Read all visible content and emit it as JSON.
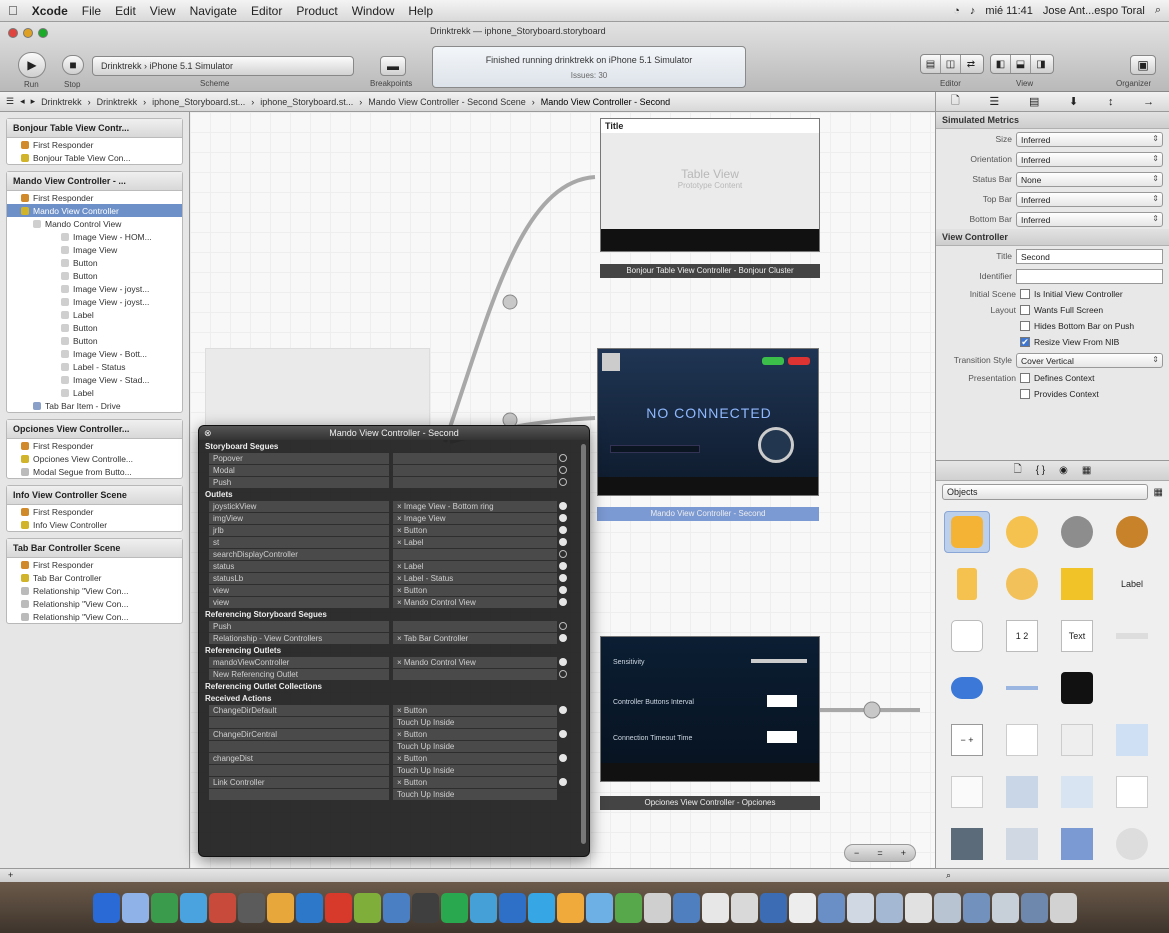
{
  "menubar": {
    "app": "Xcode",
    "menus": [
      "File",
      "Edit",
      "View",
      "Navigate",
      "Editor",
      "Product",
      "Window",
      "Help"
    ],
    "clock": "mié 11:41",
    "user": "Jose Ant...espo Toral"
  },
  "toolbar": {
    "run_label": "Run",
    "stop_label": "Stop",
    "scheme_value": "Drinktrekk › iPhone 5.1 Simulator",
    "scheme_label": "Scheme",
    "breakpoints_label": "Breakpoints",
    "doc_title": "Drinktrekk — iphone_Storyboard.storyboard",
    "status_text": "Finished running drinktrekk on iPhone 5.1 Simulator",
    "status_sub": "Issues: 30",
    "editor_label": "Editor",
    "view_label": "View",
    "organizer_label": "Organizer"
  },
  "jumpbar": {
    "crumbs": [
      "Drinktrekk",
      "Drinktrekk",
      "iphone_Storyboard.st...",
      "iphone_Storyboard.st...",
      "Mando View Controller - Second Scene",
      "Mando View Controller - Second"
    ]
  },
  "outline": {
    "scenes": [
      {
        "title": "Bonjour Table View Contr...",
        "items": [
          {
            "label": "First Responder",
            "level": 1,
            "color": "#d18a2a"
          },
          {
            "label": "Bonjour Table View Con...",
            "level": 1,
            "color": "#d1b42a"
          }
        ]
      },
      {
        "title": "Mando View Controller - ...",
        "items": [
          {
            "label": "First Responder",
            "level": 1,
            "color": "#d18a2a"
          },
          {
            "label": "Mando View Controller",
            "level": 1,
            "color": "#d1b42a",
            "selected": true
          },
          {
            "label": "Mando Control View",
            "level": 2,
            "color": "#cfcfcf"
          },
          {
            "label": "Image View - HOM...",
            "level": 3,
            "color": "#cfcfcf"
          },
          {
            "label": "Image View",
            "level": 3,
            "color": "#cfcfcf"
          },
          {
            "label": "Button",
            "level": 3,
            "color": "#cfcfcf"
          },
          {
            "label": "Button",
            "level": 3,
            "color": "#cfcfcf"
          },
          {
            "label": "Image View - joyst...",
            "level": 3,
            "color": "#cfcfcf"
          },
          {
            "label": "Image View - joyst...",
            "level": 3,
            "color": "#cfcfcf"
          },
          {
            "label": "Label",
            "level": 3,
            "color": "#cfcfcf"
          },
          {
            "label": "Button",
            "level": 3,
            "color": "#cfcfcf"
          },
          {
            "label": "Button",
            "level": 3,
            "color": "#cfcfcf"
          },
          {
            "label": "Image View - Bott...",
            "level": 3,
            "color": "#cfcfcf"
          },
          {
            "label": "Label - Status",
            "level": 3,
            "color": "#cfcfcf"
          },
          {
            "label": "Image View - Stad...",
            "level": 3,
            "color": "#cfcfcf"
          },
          {
            "label": "Label",
            "level": 3,
            "color": "#cfcfcf"
          },
          {
            "label": "Tab Bar Item - Drive",
            "level": 2,
            "color": "#8aa0c8"
          }
        ]
      },
      {
        "title": "Opciones View Controller...",
        "items": [
          {
            "label": "First Responder",
            "level": 1,
            "color": "#d18a2a"
          },
          {
            "label": "Opciones View Controlle...",
            "level": 1,
            "color": "#d1b42a"
          },
          {
            "label": "Modal Segue from Butto...",
            "level": 1,
            "color": "#bbbbbb"
          }
        ]
      },
      {
        "title": "Info View Controller Scene",
        "items": [
          {
            "label": "First Responder",
            "level": 1,
            "color": "#d18a2a"
          },
          {
            "label": "Info View Controller",
            "level": 1,
            "color": "#d1b42a"
          }
        ]
      },
      {
        "title": "Tab Bar Controller Scene",
        "items": [
          {
            "label": "First Responder",
            "level": 1,
            "color": "#d18a2a"
          },
          {
            "label": "Tab Bar Controller",
            "level": 1,
            "color": "#d1b42a"
          },
          {
            "label": "Relationship \"View Con...",
            "level": 1,
            "color": "#bbbbbb"
          },
          {
            "label": "Relationship \"View Con...",
            "level": 1,
            "color": "#bbbbbb"
          },
          {
            "label": "Relationship \"View Con...",
            "level": 1,
            "color": "#bbbbbb"
          }
        ]
      }
    ]
  },
  "canvas": {
    "table_title": "Title",
    "table_placeholder": "Table View",
    "table_sub": "Prototype Content",
    "bonjour_label": "Bonjour Table View Controller - Bonjour Cluster",
    "mando_label": "Mando View Controller - Second",
    "mando_text": "NO CONNECTED",
    "opciones_label": "Opciones View Controller - Opciones",
    "opciones_rows": [
      "Sensitivity",
      "Controller Buttons Interval",
      "Connection Timeout Time"
    ]
  },
  "hud": {
    "title": "Mando View Controller - Second",
    "groups": [
      {
        "name": "Storyboard Segues",
        "rows": [
          {
            "k": "Popover",
            "v": "",
            "dot": "empty"
          },
          {
            "k": "Modal",
            "v": "",
            "dot": "empty"
          },
          {
            "k": "Push",
            "v": "",
            "dot": "empty"
          }
        ]
      },
      {
        "name": "Outlets",
        "rows": [
          {
            "k": "joystickView",
            "v": "× Image View - Bottom ring",
            "dot": "full"
          },
          {
            "k": "imgView",
            "v": "× Image View",
            "dot": "full"
          },
          {
            "k": "jrlb",
            "v": "× Button",
            "dot": "full"
          },
          {
            "k": "st",
            "v": "× Label",
            "dot": "full"
          },
          {
            "k": "searchDisplayController",
            "v": "",
            "dot": "empty"
          },
          {
            "k": "status",
            "v": "× Label",
            "dot": "full"
          },
          {
            "k": "statusLb",
            "v": "× Label - Status",
            "dot": "full"
          },
          {
            "k": "view",
            "v": "× Button",
            "dot": "full"
          },
          {
            "k": "view",
            "v": "× Mando Control View",
            "dot": "full"
          }
        ]
      },
      {
        "name": "Referencing Storyboard Segues",
        "rows": [
          {
            "k": "Push",
            "v": "",
            "dot": "empty"
          },
          {
            "k": "Relationship - View Controllers",
            "v": "× Tab Bar Controller",
            "dot": "full"
          }
        ]
      },
      {
        "name": "Referencing Outlets",
        "rows": [
          {
            "k": "mandoViewController",
            "v": "× Mando Control View",
            "dot": "full"
          },
          {
            "k": "New Referencing Outlet",
            "v": "",
            "dot": "empty"
          }
        ]
      },
      {
        "name": "Referencing Outlet Collections",
        "rows": []
      },
      {
        "name": "Received Actions",
        "rows": [
          {
            "k": "ChangeDirDefault",
            "v": "× Button",
            "dot": "full"
          },
          {
            "k": "",
            "v": "Touch Up Inside",
            "dot": "none"
          },
          {
            "k": "ChangeDirCentral",
            "v": "× Button",
            "dot": "full"
          },
          {
            "k": "",
            "v": "Touch Up Inside",
            "dot": "none"
          },
          {
            "k": "changeDist",
            "v": "× Button",
            "dot": "full"
          },
          {
            "k": "",
            "v": "Touch Up Inside",
            "dot": "none"
          },
          {
            "k": "Link Controller",
            "v": "× Button",
            "dot": "full"
          },
          {
            "k": "",
            "v": "Touch Up Inside",
            "dot": "none"
          }
        ]
      }
    ]
  },
  "inspector": {
    "simulated_header": "Simulated Metrics",
    "simulated": [
      {
        "label": "Size",
        "value": "Inferred"
      },
      {
        "label": "Orientation",
        "value": "Inferred"
      },
      {
        "label": "Status Bar",
        "value": "None"
      },
      {
        "label": "Top Bar",
        "value": "Inferred"
      },
      {
        "label": "Bottom Bar",
        "value": "Inferred"
      }
    ],
    "vc_header": "View Controller",
    "title_label": "Title",
    "title_value": "Second",
    "identifier_label": "Identifier",
    "identifier_value": "",
    "initial_scene_label": "Initial Scene",
    "layout_label": "Layout",
    "checks": [
      {
        "label": "Is Initial View Controller",
        "checked": false,
        "prefix": "initial_scene_label"
      },
      {
        "label": "Wants Full Screen",
        "checked": false,
        "prefix": "layout_label"
      },
      {
        "label": "Hides Bottom Bar on Push",
        "checked": false,
        "prefix": ""
      },
      {
        "label": "Resize View From NIB",
        "checked": true,
        "prefix": ""
      }
    ],
    "transition_label": "Transition Style",
    "transition_value": "Cover Vertical",
    "presentation_label": "Presentation",
    "pres_checks": [
      {
        "label": "Defines Context",
        "checked": false
      },
      {
        "label": "Provides Context",
        "checked": false
      }
    ]
  },
  "library": {
    "filter": "Objects",
    "items": [
      "",
      "",
      "",
      "",
      "",
      "",
      "",
      "Label",
      "",
      "1 2",
      "Text",
      "",
      "",
      "",
      "",
      "",
      "− +",
      "",
      "",
      "",
      "",
      "",
      "",
      "",
      "",
      "",
      "",
      ""
    ]
  },
  "check_mark": "✔"
}
